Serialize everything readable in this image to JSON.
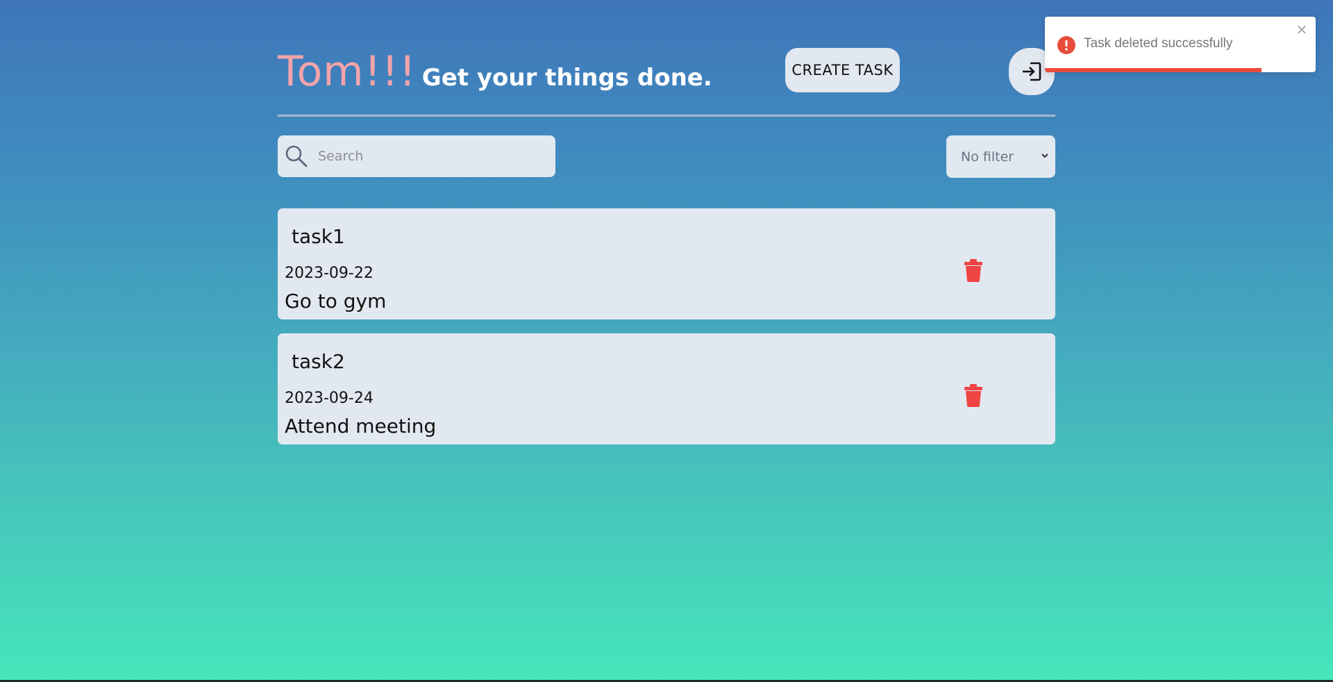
{
  "header": {
    "user_name": "Tom!!!",
    "tagline": "Get your things done.",
    "create_task_label": "CREATE TASK",
    "logout_icon": "logout-icon"
  },
  "search": {
    "placeholder": "Search",
    "value": ""
  },
  "filter": {
    "selected": "No filter"
  },
  "tasks": [
    {
      "title": "task1",
      "date": "2023-09-22",
      "description": "Go to gym"
    },
    {
      "title": "task2",
      "date": "2023-09-24",
      "description": "Attend meeting"
    }
  ],
  "toast": {
    "message": "Task deleted successfully",
    "type": "error",
    "progress": 0.8,
    "accent_color": "#e74c3c"
  },
  "colors": {
    "brand_name": "#f3a3aa",
    "card_bg": "#e2e8f0",
    "delete_icon": "#ef4444",
    "gradient_top": "#3f76b9",
    "gradient_bottom": "#46e6bb"
  }
}
